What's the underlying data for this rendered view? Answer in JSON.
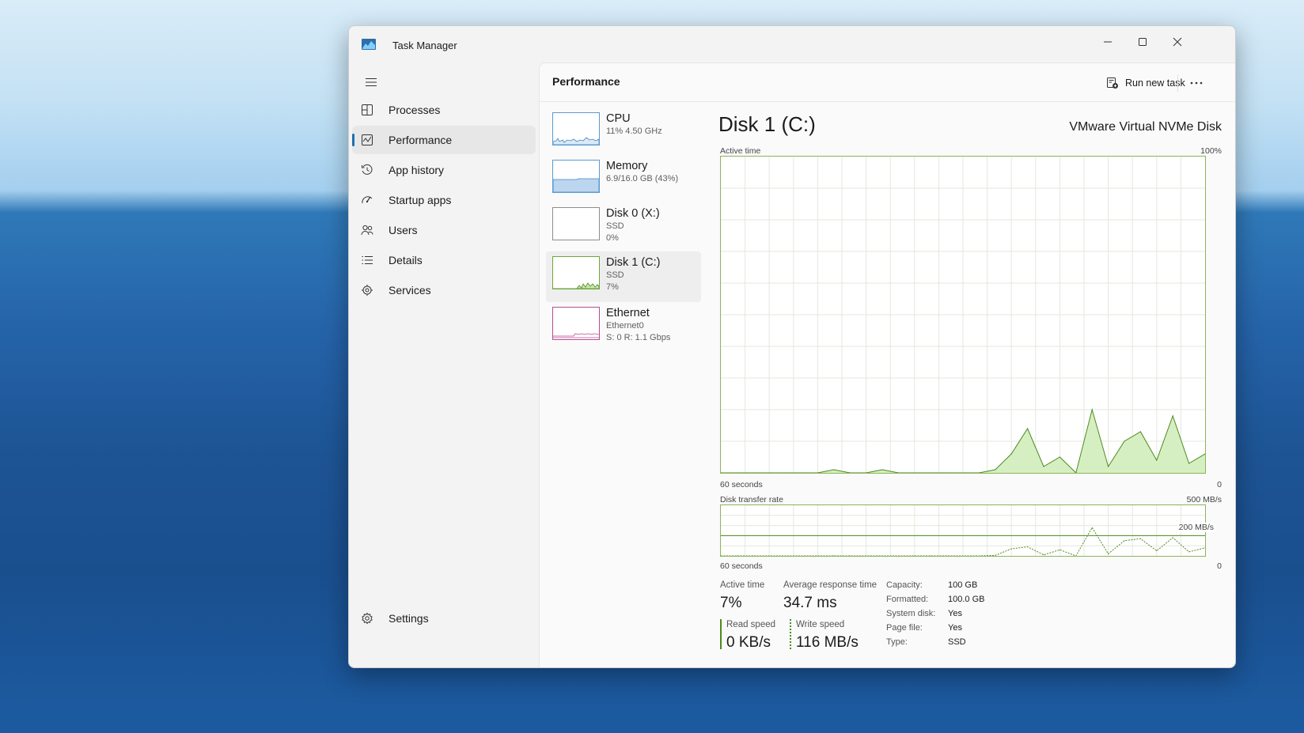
{
  "window": {
    "title": "Task Manager",
    "controls": [
      "minimize",
      "maximize",
      "close"
    ]
  },
  "nav": {
    "items": [
      {
        "label": "Processes",
        "icon": "processes-icon"
      },
      {
        "label": "Performance",
        "icon": "performance-icon",
        "active": true
      },
      {
        "label": "App history",
        "icon": "history-icon"
      },
      {
        "label": "Startup apps",
        "icon": "startup-icon"
      },
      {
        "label": "Users",
        "icon": "users-icon"
      },
      {
        "label": "Details",
        "icon": "details-icon"
      },
      {
        "label": "Services",
        "icon": "services-icon"
      }
    ],
    "settings_label": "Settings"
  },
  "header": {
    "title": "Performance",
    "run_new_task": "Run new task"
  },
  "devices": [
    {
      "name": "CPU",
      "sub1": "11% 4.50 GHz",
      "sub2": ""
    },
    {
      "name": "Memory",
      "sub1": "6.9/16.0 GB (43%)",
      "sub2": ""
    },
    {
      "name": "Disk 0 (X:)",
      "sub1": "SSD",
      "sub2": "0%"
    },
    {
      "name": "Disk 1 (C:)",
      "sub1": "SSD",
      "sub2": "7%",
      "active": true
    },
    {
      "name": "Ethernet",
      "sub1": "Ethernet0",
      "sub2": "S: 0 R: 1.1 Gbps"
    }
  ],
  "detail": {
    "title": "Disk 1 (C:)",
    "model": "VMware Virtual NVMe Disk",
    "active_graph": {
      "label": "Active time",
      "max": "100%",
      "x_left": "60 seconds",
      "x_right": "0"
    },
    "transfer_graph": {
      "label": "Disk transfer rate",
      "max": "500 MB/s",
      "ref_line": "200 MB/s",
      "x_left": "60 seconds",
      "x_right": "0"
    },
    "stats": {
      "active_time_label": "Active time",
      "active_time_value": "7%",
      "avg_response_label": "Average response time",
      "avg_response_value": "34.7 ms",
      "read_speed_label": "Read speed",
      "read_speed_value": "0 KB/s",
      "write_speed_label": "Write speed",
      "write_speed_value": "116 MB/s"
    },
    "specs": [
      {
        "label": "Capacity:",
        "value": "100 GB"
      },
      {
        "label": "Formatted:",
        "value": "100.0 GB"
      },
      {
        "label": "System disk:",
        "value": "Yes"
      },
      {
        "label": "Page file:",
        "value": "Yes"
      },
      {
        "label": "Type:",
        "value": "SSD"
      }
    ]
  },
  "chart_data": [
    {
      "type": "area",
      "title": "Active time",
      "ylabel": "Active time (%)",
      "ylim": [
        0,
        100
      ],
      "xlim": [
        60,
        0
      ],
      "x": [
        60,
        58,
        56,
        54,
        52,
        50,
        48,
        46,
        44,
        42,
        40,
        38,
        36,
        34,
        32,
        30,
        28,
        26,
        24,
        22,
        20,
        18,
        16,
        14,
        12,
        10,
        8,
        6,
        4,
        2,
        0
      ],
      "series": [
        {
          "values": [
            0,
            0,
            0,
            0,
            0,
            0,
            0,
            1,
            0,
            0,
            1,
            0,
            0,
            0,
            0,
            0,
            0,
            1,
            6,
            14,
            2,
            5,
            0,
            20,
            2,
            10,
            13,
            4,
            18,
            3,
            6
          ]
        }
      ]
    },
    {
      "type": "line",
      "title": "Disk transfer rate",
      "ylabel": "MB/s",
      "ylim": [
        0,
        500
      ],
      "xlim": [
        60,
        0
      ],
      "x": [
        60,
        58,
        56,
        54,
        52,
        50,
        48,
        46,
        44,
        42,
        40,
        38,
        36,
        34,
        32,
        30,
        28,
        26,
        24,
        22,
        20,
        18,
        16,
        14,
        12,
        10,
        8,
        6,
        4,
        2,
        0
      ],
      "series": [
        {
          "name": "Write speed",
          "values": [
            0,
            0,
            0,
            0,
            0,
            0,
            0,
            0,
            0,
            0,
            0,
            0,
            0,
            0,
            0,
            0,
            0,
            5,
            70,
            90,
            10,
            60,
            0,
            280,
            20,
            150,
            170,
            50,
            180,
            40,
            80
          ]
        }
      ]
    }
  ],
  "colors": {
    "disk_accent": "#4d8a1e",
    "disk_fill": "#d6efc2",
    "grid": "#e3e9dd",
    "cpu_line": "#3a87c7",
    "eth_line": "#b84a90"
  }
}
